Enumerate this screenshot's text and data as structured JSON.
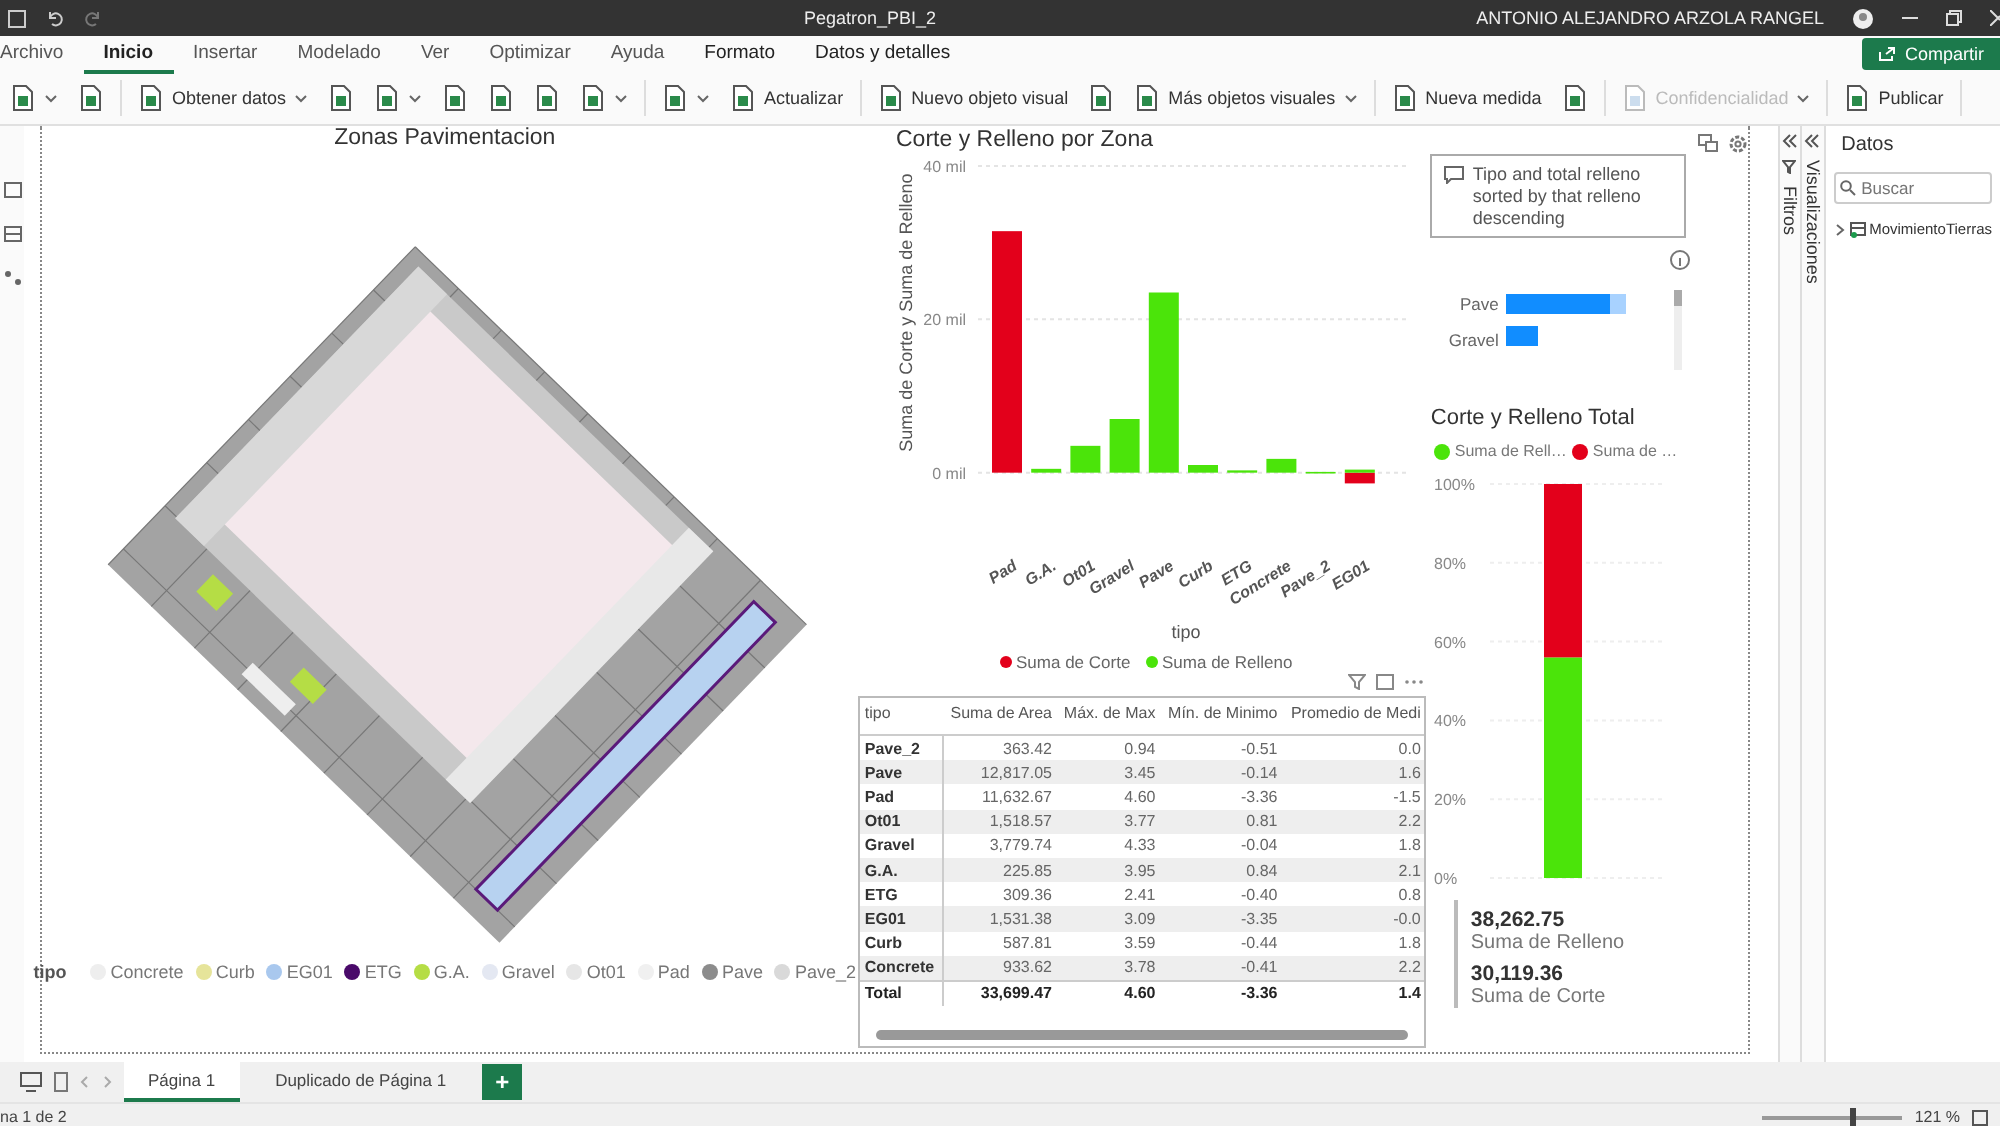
{
  "title_bar": {
    "title": "Pegatron_PBI_2",
    "user": "ANTONIO ALEJANDRO ARZOLA RANGEL"
  },
  "ribbon_tabs": [
    {
      "label": "Archivo",
      "selected": false,
      "contextual": false
    },
    {
      "label": "Inicio",
      "selected": true,
      "contextual": false
    },
    {
      "label": "Insertar",
      "selected": false,
      "contextual": false
    },
    {
      "label": "Modelado",
      "selected": false,
      "contextual": false
    },
    {
      "label": "Ver",
      "selected": false,
      "contextual": false
    },
    {
      "label": "Optimizar",
      "selected": false,
      "contextual": false
    },
    {
      "label": "Ayuda",
      "selected": false,
      "contextual": false
    },
    {
      "label": "Formato",
      "selected": false,
      "contextual": true
    },
    {
      "label": "Datos y detalles",
      "selected": false,
      "contextual": true
    }
  ],
  "share_button": {
    "label": "Compartir"
  },
  "toolbar": [
    {
      "kind": "icon",
      "dropdown": true,
      "disabled": false
    },
    {
      "kind": "icon",
      "dropdown": false,
      "disabled": false
    },
    {
      "kind": "separator"
    },
    {
      "kind": "button",
      "label": "Obtener datos",
      "dropdown": true,
      "disabled": false
    },
    {
      "kind": "icon",
      "dropdown": false,
      "disabled": false
    },
    {
      "kind": "icon",
      "dropdown": true,
      "disabled": false
    },
    {
      "kind": "icon",
      "dropdown": false,
      "disabled": false
    },
    {
      "kind": "icon",
      "dropdown": false,
      "disabled": false
    },
    {
      "kind": "icon",
      "dropdown": false,
      "disabled": false
    },
    {
      "kind": "icon",
      "dropdown": true,
      "disabled": false
    },
    {
      "kind": "separator"
    },
    {
      "kind": "icon",
      "dropdown": true,
      "disabled": false
    },
    {
      "kind": "button",
      "label": "Actualizar",
      "dropdown": false,
      "disabled": false
    },
    {
      "kind": "separator"
    },
    {
      "kind": "button",
      "label": "Nuevo objeto visual",
      "dropdown": false,
      "disabled": false
    },
    {
      "kind": "icon",
      "dropdown": false,
      "disabled": false
    },
    {
      "kind": "button",
      "label": "Más objetos visuales",
      "dropdown": true,
      "disabled": false
    },
    {
      "kind": "separator"
    },
    {
      "kind": "button",
      "label": "Nueva medida",
      "dropdown": false,
      "disabled": false
    },
    {
      "kind": "icon",
      "dropdown": false,
      "disabled": false
    },
    {
      "kind": "separator"
    },
    {
      "kind": "button",
      "label": "Confidencialidad",
      "dropdown": true,
      "disabled": true
    },
    {
      "kind": "separator"
    },
    {
      "kind": "button",
      "label": "Publicar",
      "dropdown": false,
      "disabled": false
    },
    {
      "kind": "separator"
    }
  ],
  "map": {
    "title": "Zonas Pavimentacion",
    "legend_title": "tipo",
    "legend": [
      {
        "label": "Concrete",
        "color": "#eeeeee"
      },
      {
        "label": "Curb",
        "color": "#e6e49a"
      },
      {
        "label": "EG01",
        "color": "#a9c8ee"
      },
      {
        "label": "ETG",
        "color": "#4a0a6a"
      },
      {
        "label": "G.A.",
        "color": "#b5dd45"
      },
      {
        "label": "Gravel",
        "color": "#e4e8f2"
      },
      {
        "label": "Ot01",
        "color": "#e6e6e6"
      },
      {
        "label": "Pad",
        "color": "#f0f0f0"
      },
      {
        "label": "Pave",
        "color": "#8c8c8c"
      },
      {
        "label": "Pave_2",
        "color": "#d9d9d9"
      }
    ]
  },
  "bar_chart": {
    "chart_data": {
      "type": "bar",
      "title": "Corte y Relleno por Zona",
      "xlabel": "tipo",
      "ylabel": "Suma de Corte y Suma de Relleno",
      "stacked": true,
      "categories": [
        "Pad",
        "G.A.",
        "Ot01",
        "Gravel",
        "Pave",
        "Curb",
        "ETG",
        "Concrete",
        "Pave_2",
        "EG01"
      ],
      "series": [
        {
          "name": "Suma de Corte",
          "color": "#e3001b",
          "values": [
            31.5,
            null,
            null,
            null,
            null,
            null,
            null,
            null,
            null,
            -1.4
          ]
        },
        {
          "name": "Suma de Relleno",
          "color": "#4be40a",
          "values": [
            null,
            0.5,
            3.5,
            7,
            23.5,
            1,
            0.3,
            1.8,
            0.1,
            0.4
          ]
        }
      ],
      "legend": "bottom",
      "grid": true,
      "ylim": [
        -2,
        40
      ],
      "yticks": [
        {
          "value": 0,
          "label": "0 mil"
        },
        {
          "value": 20,
          "label": "20 mil"
        },
        {
          "value": 40,
          "label": "40 mil"
        }
      ]
    }
  },
  "qa": {
    "text": "Tipo and total relleno sorted by that relleno descending",
    "bars": [
      {
        "label": "Pave"
      },
      {
        "label": "Gravel"
      }
    ]
  },
  "table": {
    "columns": [
      "tipo",
      "Suma de Area",
      "Máx. de Max",
      "Mín. de Minimo",
      "Promedio de Medi"
    ],
    "rows": [
      [
        "Pave_2",
        "363.42",
        "0.94",
        "-0.51",
        "0.0"
      ],
      [
        "Pave",
        "12,817.05",
        "3.45",
        "-0.14",
        "1.6"
      ],
      [
        "Pad",
        "11,632.67",
        "4.60",
        "-3.36",
        "-1.5"
      ],
      [
        "Ot01",
        "1,518.57",
        "3.77",
        "0.81",
        "2.2"
      ],
      [
        "Gravel",
        "3,779.74",
        "4.33",
        "-0.04",
        "1.8"
      ],
      [
        "G.A.",
        "225.85",
        "3.95",
        "0.84",
        "2.1"
      ],
      [
        "ETG",
        "309.36",
        "2.41",
        "-0.40",
        "0.8"
      ],
      [
        "EG01",
        "1,531.38",
        "3.09",
        "-3.35",
        "-0.0"
      ],
      [
        "Curb",
        "587.81",
        "3.59",
        "-0.44",
        "1.8"
      ],
      [
        "Concrete",
        "933.62",
        "3.78",
        "-0.41",
        "2.2"
      ]
    ],
    "total": [
      "Total",
      "33,699.47",
      "4.60",
      "-3.36",
      "1.4"
    ]
  },
  "total_chart": {
    "chart_data": {
      "type": "bar",
      "title": "Corte y Relleno Total",
      "stacked": true,
      "series": [
        {
          "name": "Suma de Rell…",
          "color": "#4be40a",
          "values": [
            56
          ]
        },
        {
          "name": "Suma de …",
          "color": "#e3001b",
          "values": [
            44
          ]
        }
      ],
      "legend": "top",
      "grid": true,
      "ylim": [
        0,
        100
      ],
      "yticks": [
        {
          "value": 0,
          "label": "0%"
        },
        {
          "value": 20,
          "label": "20%"
        },
        {
          "value": 40,
          "label": "40%"
        },
        {
          "value": 60,
          "label": "60%"
        },
        {
          "value": 80,
          "label": "80%"
        },
        {
          "value": 100,
          "label": "100%"
        }
      ]
    }
  },
  "card": [
    {
      "value": "38,262.75",
      "label": "Suma de Relleno"
    },
    {
      "value": "30,119.36",
      "label": "Suma de Corte"
    }
  ],
  "panes": {
    "filters": "Filtros",
    "visualizations": "Visualizaciones"
  },
  "data_pane": {
    "title": "Datos",
    "search": {
      "placeholder": "Buscar"
    },
    "tables": [
      {
        "name": "MovimientoTierras",
        "expanded": false
      }
    ]
  },
  "page_tabs": [
    {
      "label": "Página 1",
      "selected": true
    },
    {
      "label": "Duplicado de Página 1",
      "selected": false
    }
  ],
  "add_page": "+",
  "status_bar": {
    "page": "na 1 de 2",
    "zoom": {
      "level": 0.62,
      "reading": "121 %"
    }
  }
}
